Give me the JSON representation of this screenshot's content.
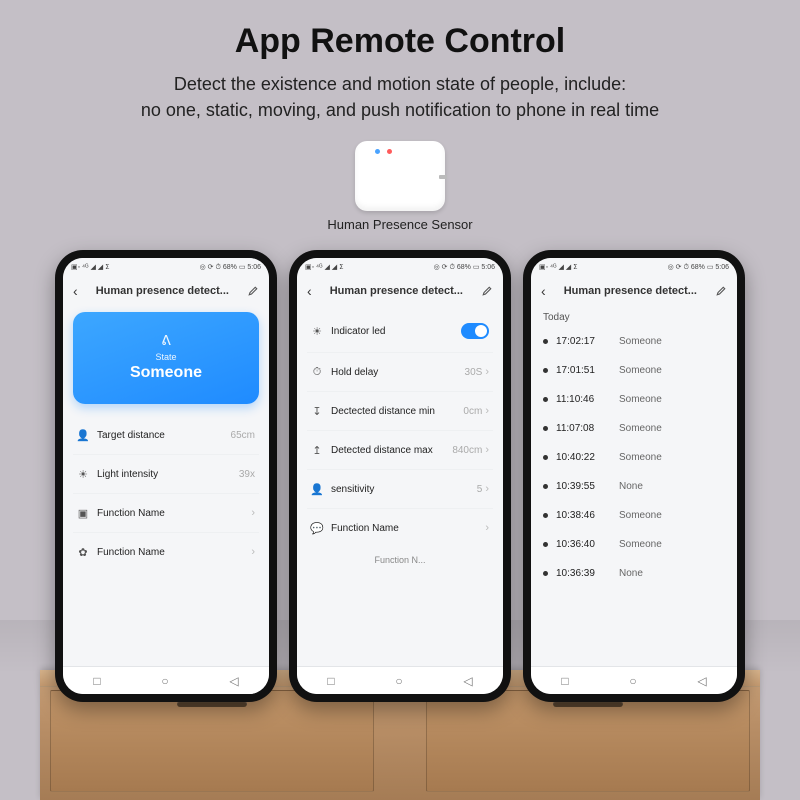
{
  "heading": "App Remote Control",
  "sub1": "Detect the existence and motion state of people, include:",
  "sub2": "no one, static, moving, and push notification to phone in real time",
  "device_label": "Human Presence Sensor",
  "status_left": "▣◦ ⁴ᴳ ◢ ◢ ⵉ",
  "status_right": "◎ ⟳ ⏱ 68% ▭ 5:06",
  "app_title": "Human presence detect...",
  "phone1": {
    "state_label": "State",
    "state_value": "Someone",
    "rows": [
      {
        "icon": "👤",
        "name": "Target distance",
        "value": "65cm"
      },
      {
        "icon": "☀",
        "name": "Light intensity",
        "value": "39x"
      },
      {
        "icon": "▣",
        "name": "Function Name",
        "value": ""
      },
      {
        "icon": "✿",
        "name": "Function Name",
        "value": ""
      }
    ]
  },
  "phone2": {
    "rows": [
      {
        "icon": "☀",
        "name": "Indicator led",
        "toggle": true
      },
      {
        "icon": "⏱",
        "name": "Hold delay",
        "value": "30S"
      },
      {
        "icon": "↧",
        "name": "Dectected distance min",
        "value": "0cm"
      },
      {
        "icon": "↥",
        "name": "Detected distance max",
        "value": "840cm"
      },
      {
        "icon": "👤",
        "name": "sensitivity",
        "value": "5"
      },
      {
        "icon": "💬",
        "name": "Function Name",
        "value": ""
      }
    ],
    "footer": "Function N..."
  },
  "phone3": {
    "today": "Today",
    "logs": [
      {
        "t": "17:02:17",
        "s": "Someone"
      },
      {
        "t": "17:01:51",
        "s": "Someone"
      },
      {
        "t": "11:10:46",
        "s": "Someone"
      },
      {
        "t": "11:07:08",
        "s": "Someone"
      },
      {
        "t": "10:40:22",
        "s": "Someone"
      },
      {
        "t": "10:39:55",
        "s": "None"
      },
      {
        "t": "10:38:46",
        "s": "Someone"
      },
      {
        "t": "10:36:40",
        "s": "Someone"
      },
      {
        "t": "10:36:39",
        "s": "None"
      }
    ]
  },
  "nav": {
    "sq": "□",
    "circ": "○",
    "tri": "◁"
  }
}
